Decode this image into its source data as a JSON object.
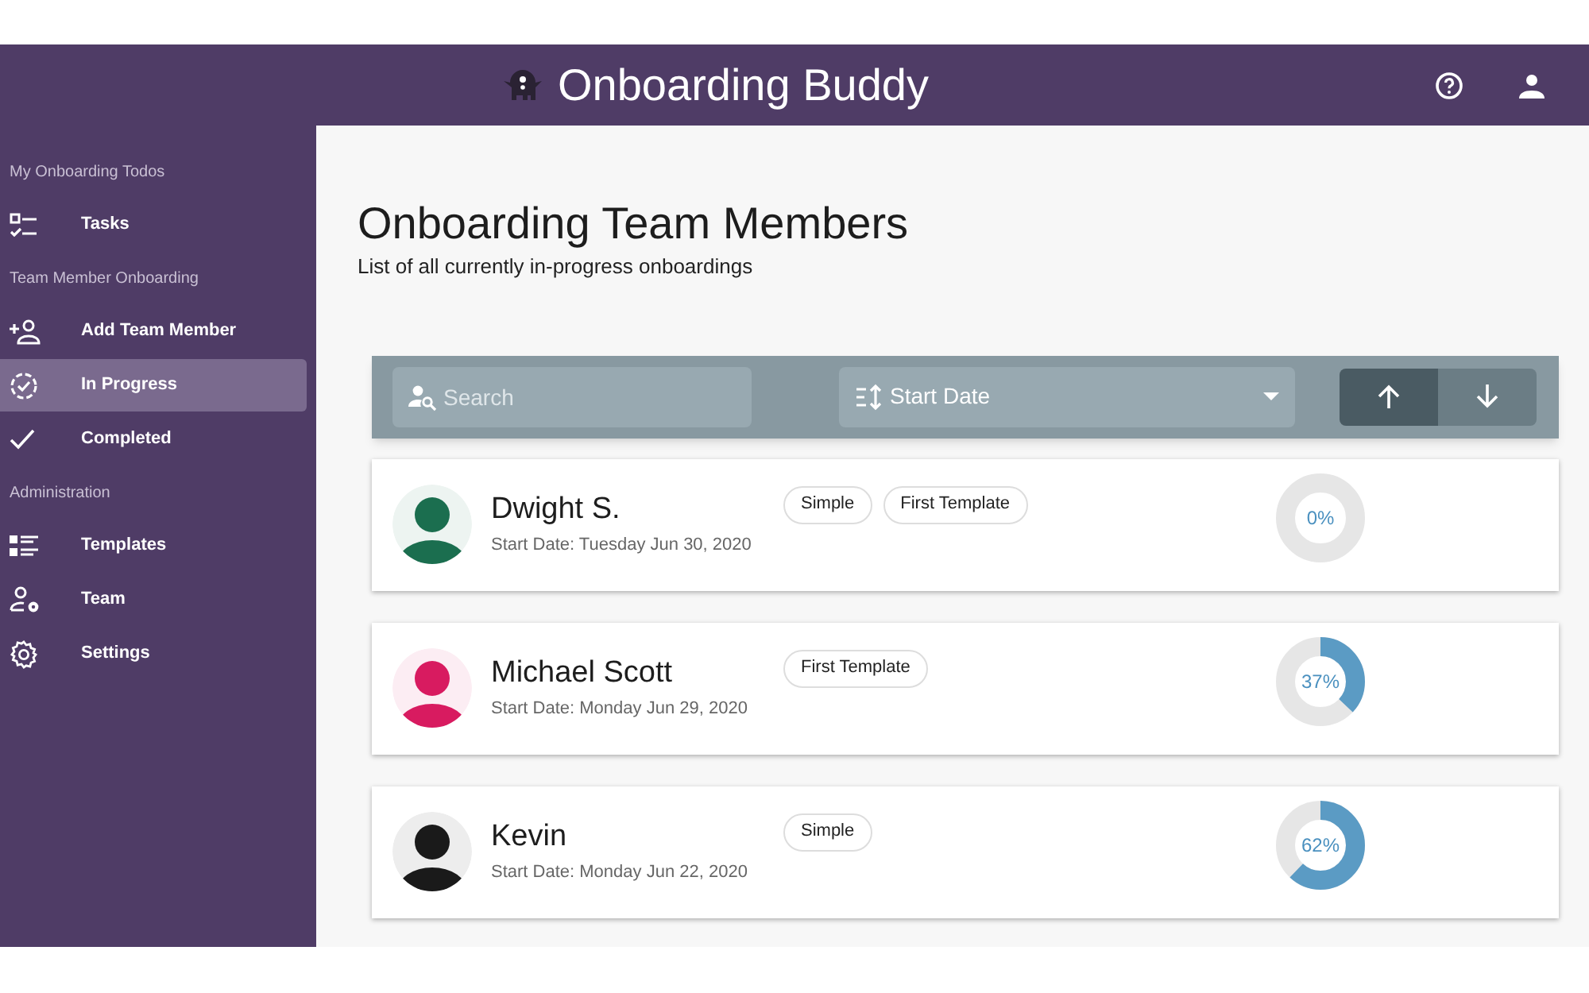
{
  "header": {
    "title": "Onboarding Buddy"
  },
  "sidebar": {
    "sections": [
      {
        "heading": "My Onboarding Todos",
        "items": [
          {
            "label": "Tasks",
            "kind": "tasks",
            "selected": false
          }
        ]
      },
      {
        "heading": "Team Member Onboarding",
        "items": [
          {
            "label": "Add Team Member",
            "kind": "add",
            "selected": false
          },
          {
            "label": "In Progress",
            "kind": "progress",
            "selected": true
          },
          {
            "label": "Completed",
            "kind": "completed",
            "selected": false
          }
        ]
      },
      {
        "heading": "Administration",
        "items": [
          {
            "label": "Templates",
            "kind": "templates",
            "selected": false
          },
          {
            "label": "Team",
            "kind": "team",
            "selected": false
          },
          {
            "label": "Settings",
            "kind": "settings",
            "selected": false
          }
        ]
      }
    ]
  },
  "page": {
    "title": "Onboarding Team Members",
    "subtitle": "List of all currently in-progress onboardings"
  },
  "toolbar": {
    "search": {
      "placeholder": "Search"
    },
    "sort": {
      "value": "Start Date"
    },
    "direction": [
      {
        "kind": "up",
        "selected": true
      },
      {
        "kind": "down",
        "selected": false
      }
    ]
  },
  "members": [
    {
      "name": "Dwight S.",
      "start_date": "Start Date: Tuesday Jun 30, 2020",
      "color": "#1b6e4f",
      "tags": [
        "Simple",
        "First Template"
      ],
      "progress": "0%"
    },
    {
      "name": "Michael Scott",
      "start_date": "Start Date: Monday Jun 29, 2020",
      "color": "#d81b60",
      "tags": [
        "First Template"
      ],
      "progress": "37%"
    },
    {
      "name": "Kevin",
      "start_date": "Start Date: Monday Jun 22, 2020",
      "color": "#1a1a1a",
      "tags": [
        "Simple"
      ],
      "progress": "62%"
    }
  ]
}
